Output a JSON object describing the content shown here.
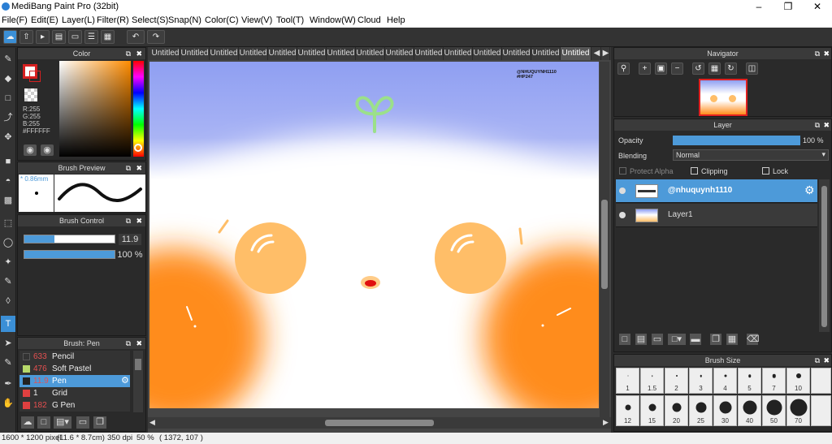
{
  "window": {
    "title": "MediBang Paint Pro (32bit)"
  },
  "menu": [
    "File(F)",
    "Edit(E)",
    "Layer(L)",
    "Filter(R)",
    "Select(S)",
    "Snap(N)",
    "Color(C)",
    "View(V)",
    "Tool(T)",
    "Window(W)",
    "Cloud",
    "Help"
  ],
  "color_panel": {
    "title": "Color",
    "r": "R:255",
    "g": "G:255",
    "b": "B:255",
    "hex": "#FFFFFF"
  },
  "brush_preview": {
    "title": "Brush Preview",
    "size": "* 0.86mm"
  },
  "brush_control": {
    "title": "Brush Control",
    "size_value": "11.9",
    "opacity_value": "100 %",
    "size_fraction": 0.33,
    "opacity_fraction": 1.0
  },
  "brush_list": {
    "title": "Brush: Pen",
    "items": [
      {
        "num": "633",
        "name": "Pencil",
        "swatch": "#333333"
      },
      {
        "num": "476",
        "name": "Soft Pastel",
        "swatch": "#b7d96a"
      },
      {
        "num": "11.9",
        "name": "Pen",
        "swatch": "#222222",
        "selected": true
      },
      {
        "num": "1",
        "name": "Grid",
        "swatch": "#e04040"
      },
      {
        "num": "182",
        "name": "G Pen",
        "swatch": "#e04040"
      }
    ]
  },
  "tabs": [
    "Untitled",
    "Untitled",
    "Untitled",
    "Untitled",
    "Untitled",
    "Untitled",
    "Untitled",
    "Untitled",
    "Untitled",
    "Untitled",
    "Untitled",
    "Untitled",
    "Untitled",
    "Untitled",
    "Untitled"
  ],
  "canvas": {
    "watermark_line1": "@NHUQUYNH1110",
    "watermark_line2": "#HP247"
  },
  "navigator": {
    "title": "Navigator"
  },
  "layer_panel": {
    "title": "Layer",
    "opacity_label": "Opacity",
    "opacity_value": "100 %",
    "opacity_fraction": 1.0,
    "blending_label": "Blending",
    "blending_value": "Normal",
    "protect_alpha": "Protect Alpha",
    "clipping": "Clipping",
    "lock": "Lock",
    "layers": [
      {
        "name": "@nhuquynh1110",
        "selected": true
      },
      {
        "name": "Layer1",
        "selected": false
      }
    ]
  },
  "brush_size": {
    "title": "Brush Size",
    "row1": [
      "1",
      "1.5",
      "2",
      "3",
      "4",
      "5",
      "7",
      "10"
    ],
    "row2": [
      "12",
      "15",
      "20",
      "25",
      "30",
      "40",
      "50",
      "70"
    ]
  },
  "status": {
    "dims": "1600 * 1200 pixel",
    "cm": "(11.6 * 8.7cm)",
    "dpi": "350 dpi",
    "zoom": "50 %",
    "coords": "( 1372, 107 )"
  },
  "colors": {
    "accent": "#4d9ad9",
    "orange": "#ff8c1a",
    "sky": "#8f9ff2"
  }
}
